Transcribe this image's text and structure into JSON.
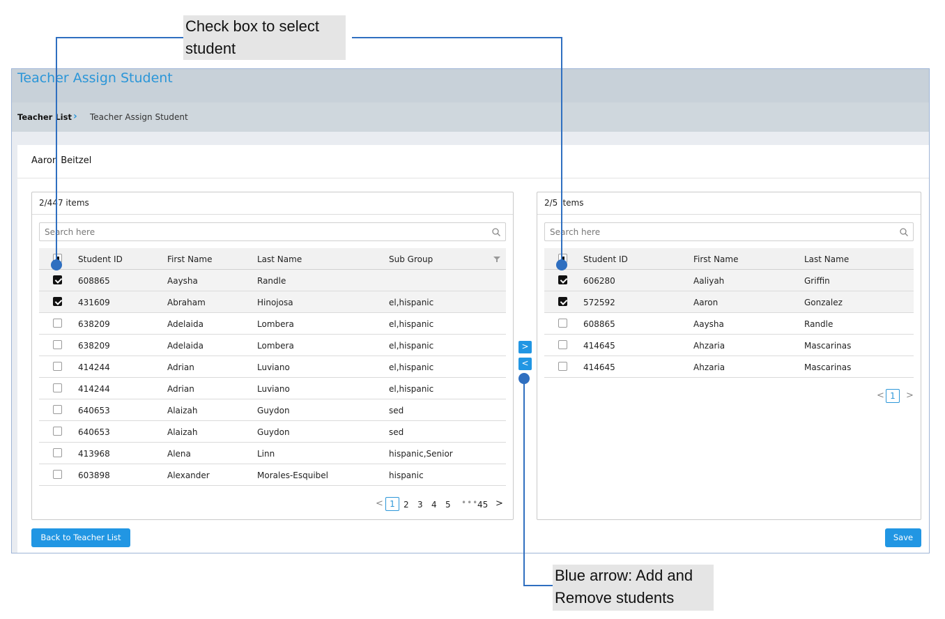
{
  "page": {
    "title": "Teacher Assign Student",
    "breadcrumb": [
      "Teacher List",
      "Teacher Assign Student"
    ],
    "teacher_name": "Aaron Beitzel",
    "colors": {
      "accent": "#2196e3",
      "annotation": "#2f6fc0"
    }
  },
  "annotations": {
    "checkbox_callout_line1": "Check box to select",
    "checkbox_callout_line2": "student",
    "arrow_callout_line1": "Blue arrow: Add and",
    "arrow_callout_line2": "Remove students"
  },
  "left_panel": {
    "count": "2/447 items",
    "search_placeholder": "Search here",
    "columns": [
      "Student ID",
      "First Name",
      "Last Name",
      "Sub Group"
    ],
    "rows": [
      {
        "checked": true,
        "id": "608865",
        "first": "Aaysha",
        "last": "Randle",
        "group": ""
      },
      {
        "checked": true,
        "id": "431609",
        "first": "Abraham",
        "last": "Hinojosa",
        "group": "el,hispanic"
      },
      {
        "checked": false,
        "id": "638209",
        "first": "Adelaida",
        "last": "Lombera",
        "group": "el,hispanic"
      },
      {
        "checked": false,
        "id": "638209",
        "first": "Adelaida",
        "last": "Lombera",
        "group": "el,hispanic"
      },
      {
        "checked": false,
        "id": "414244",
        "first": "Adrian",
        "last": "Luviano",
        "group": "el,hispanic"
      },
      {
        "checked": false,
        "id": "414244",
        "first": "Adrian",
        "last": "Luviano",
        "group": "el,hispanic"
      },
      {
        "checked": false,
        "id": "640653",
        "first": "Alaizah",
        "last": "Guydon",
        "group": "sed"
      },
      {
        "checked": false,
        "id": "640653",
        "first": "Alaizah",
        "last": "Guydon",
        "group": "sed"
      },
      {
        "checked": false,
        "id": "413968",
        "first": "Alena",
        "last": "Linn",
        "group": "hispanic,Senior"
      },
      {
        "checked": false,
        "id": "603898",
        "first": "Alexander",
        "last": "Morales-Esquibel",
        "group": "hispanic"
      }
    ],
    "pagination": {
      "prev": "<",
      "current": "1",
      "pages": [
        "2",
        "3",
        "4",
        "5"
      ],
      "dots": "•••",
      "last": "45",
      "next": ">"
    }
  },
  "right_panel": {
    "count": "2/5 items",
    "search_placeholder": "Search here",
    "columns": [
      "Student ID",
      "First Name",
      "Last Name"
    ],
    "rows": [
      {
        "checked": true,
        "id": "606280",
        "first": "Aaliyah",
        "last": "Griffin"
      },
      {
        "checked": true,
        "id": "572592",
        "first": "Aaron",
        "last": "Gonzalez"
      },
      {
        "checked": false,
        "id": "608865",
        "first": "Aaysha",
        "last": "Randle"
      },
      {
        "checked": false,
        "id": "414645",
        "first": "Ahzaria",
        "last": "Mascarinas"
      },
      {
        "checked": false,
        "id": "414645",
        "first": "Ahzaria",
        "last": "Mascarinas"
      }
    ],
    "pagination": {
      "prev": "<",
      "current": "1",
      "next": ">"
    }
  },
  "transfer": {
    "add": ">",
    "remove": "<"
  },
  "buttons": {
    "back": "Back to Teacher List",
    "save": "Save"
  }
}
